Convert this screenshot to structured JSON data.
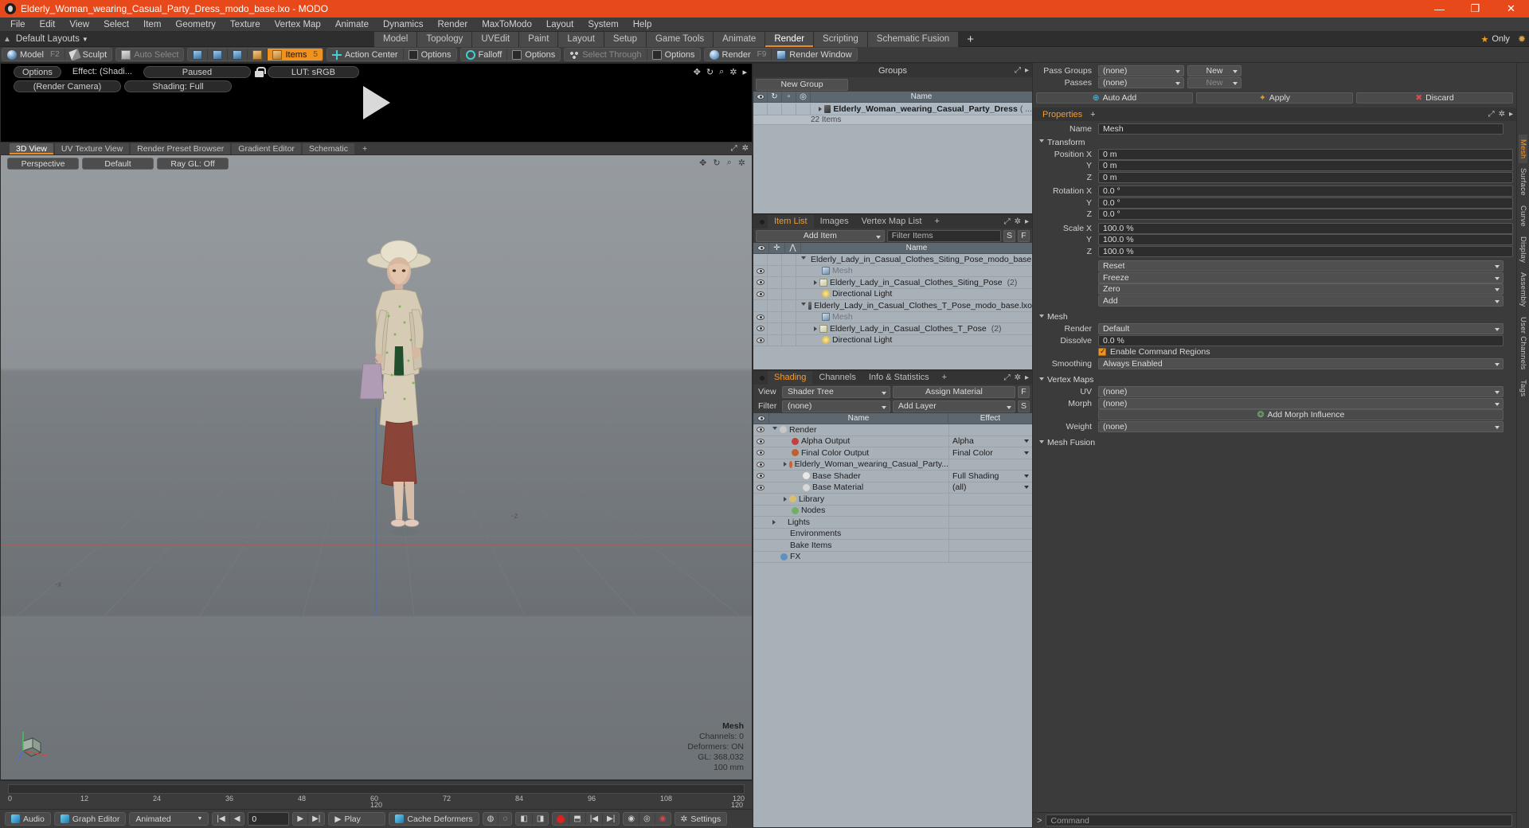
{
  "window": {
    "title": "Elderly_Woman_wearing_Casual_Party_Dress_modo_base.lxo - MODO",
    "minimize": "—",
    "maximize": "❐",
    "close": "✕"
  },
  "menu": [
    "File",
    "Edit",
    "View",
    "Select",
    "Item",
    "Geometry",
    "Texture",
    "Vertex Map",
    "Animate",
    "Dynamics",
    "Render",
    "MaxToModo",
    "Layout",
    "System",
    "Help"
  ],
  "layout_row": {
    "layout_selector": "Default Layouts",
    "tabs": [
      {
        "label": "Model",
        "active": false
      },
      {
        "label": "Topology",
        "active": false
      },
      {
        "label": "UVEdit",
        "active": false
      },
      {
        "label": "Paint",
        "active": false
      },
      {
        "label": "Layout",
        "active": false
      },
      {
        "label": "Setup",
        "active": false
      },
      {
        "label": "Game Tools",
        "active": false
      },
      {
        "label": "Animate",
        "active": false
      },
      {
        "label": "Render",
        "active": true
      },
      {
        "label": "Scripting",
        "active": false
      },
      {
        "label": "Schematic Fusion",
        "active": false
      },
      {
        "label": "+",
        "active": false
      }
    ],
    "only_label": "Only"
  },
  "toolbar": {
    "mode_group": [
      {
        "label": "Model",
        "key": "F2",
        "icon": "sphere-icon",
        "active": false
      },
      {
        "label": "Sculpt",
        "key": "",
        "icon": "brush-icon",
        "active": false
      }
    ],
    "select_group": [
      {
        "label": "Auto Select",
        "icon": "cube-icon",
        "dim": true
      }
    ],
    "component_icons": [
      "vertex-mode-icon",
      "edge-mode-icon",
      "polygon-mode-icon",
      "material-mode-icon"
    ],
    "items_button": {
      "label": "Items",
      "key": "5",
      "active": true,
      "icon": "items-cube-icon"
    },
    "action_center": {
      "label": "Action Center",
      "icon": "action-center-icon"
    },
    "options_1": {
      "label": "Options",
      "icon": "options-icon"
    },
    "falloff": {
      "label": "Falloff",
      "icon": "falloff-icon"
    },
    "options_2": {
      "label": "Options",
      "icon": "options-icon"
    },
    "select_through": {
      "label": "Select Through",
      "icon": "select-through-icon",
      "dim": true
    },
    "options_3": {
      "label": "Options",
      "icon": "options-icon"
    },
    "render": {
      "label": "Render",
      "key": "F9",
      "icon": "render-icon"
    },
    "render_window": {
      "label": "Render Window",
      "icon": "render-window-icon"
    }
  },
  "preview": {
    "options": "Options",
    "effect": "Effect: (Shadi...",
    "paused": "Paused",
    "lut": "LUT: sRGB",
    "camera": "(Render Camera)",
    "shading": "Shading: Full",
    "icons": [
      "move-icon",
      "rotate-icon",
      "zoom-icon",
      "gear-icon",
      "chevron-right-icon"
    ]
  },
  "viewport": {
    "tabs": [
      {
        "label": "3D View",
        "active": true
      },
      {
        "label": "UV Texture View",
        "active": false
      },
      {
        "label": "Render Preset Browser",
        "active": false
      },
      {
        "label": "Gradient Editor",
        "active": false
      },
      {
        "label": "Schematic",
        "active": false
      },
      {
        "label": "+",
        "active": false
      }
    ],
    "perspective": "Perspective",
    "default": "Default",
    "raygl": "Ray GL: Off",
    "icons": [
      "move-icon",
      "rotate-icon",
      "zoom-icon",
      "gear-icon"
    ],
    "stats": {
      "title": "Mesh",
      "channels": "Channels: 0",
      "deformers": "Deformers: ON",
      "gl": "GL: 368,032",
      "scale": "100 mm"
    },
    "axis_labels": {
      "z_minus": "-z",
      "x_minus": "-x"
    }
  },
  "timeline": {
    "ticks": [
      "0",
      "12",
      "24",
      "36",
      "48",
      "60",
      "72",
      "84",
      "96",
      "108",
      "120"
    ],
    "center": "120",
    "right": "120"
  },
  "bottom_bar": {
    "audio": "Audio",
    "graph_editor": "Graph Editor",
    "animated": "Animated",
    "frame_value": "0",
    "play": "Play",
    "cache_deformers": "Cache Deformers",
    "settings": "Settings"
  },
  "groups_panel": {
    "title": "Groups",
    "new_group_button": "New Group",
    "columns": [
      "eye",
      "sync",
      "lock",
      "render",
      "Name"
    ],
    "items": [
      {
        "name": "Elderly_Woman_wearing_Casual_Party_Dress",
        "suffix": "( ...",
        "sub": "22 Items"
      }
    ]
  },
  "item_list_panel": {
    "tabs": [
      {
        "label": "Item List",
        "active": true
      },
      {
        "label": "Images",
        "active": false
      },
      {
        "label": "Vertex Map List",
        "active": false
      },
      {
        "label": "+",
        "active": false
      }
    ],
    "add_item_button": "Add Item",
    "filter_placeholder": "Filter Items",
    "filter_s": "S",
    "filter_f": "F",
    "columns": [
      "eye",
      "move",
      "axis",
      "Name"
    ],
    "rows": [
      {
        "indent": 0,
        "tri": "down",
        "icon": "clapboard-icon",
        "name": "Elderly_Lady_in_Casual_Clothes_Siting_Pose_modo_base.lxo",
        "dim": false,
        "eye": false
      },
      {
        "indent": 1,
        "tri": "none",
        "icon": "mesh-icon",
        "name": "Mesh",
        "dim": true,
        "eye": true
      },
      {
        "indent": 1,
        "tri": "right",
        "icon": "folder-icon",
        "name": "Elderly_Lady_in_Casual_Clothes_Siting_Pose",
        "suffix": "(2)",
        "dim": false,
        "eye": true
      },
      {
        "indent": 1,
        "tri": "none",
        "icon": "light-icon",
        "name": "Directional Light",
        "dim": false,
        "eye": true
      },
      {
        "indent": 0,
        "tri": "down",
        "icon": "clapboard-icon",
        "name": "Elderly_Lady_in_Casual_Clothes_T_Pose_modo_base.lxo",
        "dim": false,
        "eye": false
      },
      {
        "indent": 1,
        "tri": "none",
        "icon": "mesh-icon",
        "name": "Mesh",
        "dim": true,
        "eye": true
      },
      {
        "indent": 1,
        "tri": "right",
        "icon": "folder-icon",
        "name": "Elderly_Lady_in_Casual_Clothes_T_Pose",
        "suffix": "(2)",
        "dim": false,
        "eye": true
      },
      {
        "indent": 1,
        "tri": "none",
        "icon": "light-icon",
        "name": "Directional Light",
        "dim": false,
        "eye": true
      }
    ]
  },
  "shading_panel": {
    "tabs": [
      {
        "label": "Shading",
        "active": true
      },
      {
        "label": "Channels",
        "active": false
      },
      {
        "label": "Info & Statistics",
        "active": false
      },
      {
        "label": "+",
        "active": false
      }
    ],
    "view_label": "View",
    "view_value": "Shader Tree",
    "assign_material": "Assign Material",
    "assign_f": "F",
    "filter_label": "Filter",
    "filter_value": "(none)",
    "add_layer": "Add Layer",
    "add_layer_s": "S",
    "columns": [
      "eye",
      "Name",
      "Effect"
    ],
    "rows": [
      {
        "indent": 0,
        "tri": "down",
        "icon": "render-icon",
        "name": "Render",
        "effect": "",
        "eye": true
      },
      {
        "indent": 1,
        "tri": "none",
        "icon": "alpha-icon",
        "name": "Alpha Output",
        "effect": "Alpha",
        "eye": true,
        "dd": true
      },
      {
        "indent": 1,
        "tri": "none",
        "icon": "color-icon",
        "name": "Final Color Output",
        "effect": "Final Color",
        "eye": true,
        "dd": true
      },
      {
        "indent": 1,
        "tri": "right",
        "icon": "material-icon",
        "name": "Elderly_Woman_wearing_Casual_Party...",
        "effect": "",
        "eye": true
      },
      {
        "indent": 2,
        "tri": "none",
        "icon": "shader-icon",
        "name": "Base Shader",
        "effect": "Full Shading",
        "eye": true,
        "dd": true
      },
      {
        "indent": 2,
        "tri": "none",
        "icon": "basemat-icon",
        "name": "Base Material",
        "effect": "(all)",
        "eye": true,
        "dd": true
      },
      {
        "indent": 1,
        "tri": "right",
        "icon": "library-icon",
        "name": "Library",
        "effect": "",
        "eye": false
      },
      {
        "indent": 1,
        "tri": "none",
        "icon": "nodes-icon",
        "name": "Nodes",
        "effect": "",
        "eye": false
      },
      {
        "indent": 0,
        "tri": "right",
        "icon": "none",
        "name": "Lights",
        "effect": "",
        "eye": false
      },
      {
        "indent": 0,
        "tri": "none",
        "icon": "none",
        "name": "Environments",
        "effect": "",
        "eye": false
      },
      {
        "indent": 0,
        "tri": "none",
        "icon": "none",
        "name": "Bake Items",
        "effect": "",
        "eye": false
      },
      {
        "indent": 0,
        "tri": "none",
        "icon": "fx-icon",
        "name": "FX",
        "effect": "",
        "eye": false
      }
    ]
  },
  "properties": {
    "pass_groups_label": "Pass Groups",
    "pass_groups_value": "(none)",
    "new_button": "New",
    "passes_label": "Passes",
    "passes_value": "(none)",
    "new_button_2": "New",
    "auto_add": "Auto Add",
    "apply": "Apply",
    "discard": "Discard",
    "header": "Properties",
    "header_plus": "+",
    "name_label": "Name",
    "name_value": "Mesh",
    "transform_section": "Transform",
    "position": {
      "label": "Position X",
      "x": "0 m",
      "y": "0 m",
      "z": "0 m"
    },
    "rotation": {
      "label": "Rotation X",
      "x": "0.0 °",
      "y": "0.0 °",
      "z": "0.0 °"
    },
    "scale": {
      "label": "Scale X",
      "x": "100.0 %",
      "y": "100.0 %",
      "z": "100.0 %"
    },
    "transform_actions": [
      "Reset",
      "Freeze",
      "Zero",
      "Add"
    ],
    "mesh_section": "Mesh",
    "render_label": "Render",
    "render_value": "Default",
    "dissolve_label": "Dissolve",
    "dissolve_value": "0.0 %",
    "enable_command_regions": "Enable Command Regions",
    "smoothing_label": "Smoothing",
    "smoothing_value": "Always Enabled",
    "vertex_maps_section": "Vertex Maps",
    "uv_label": "UV",
    "uv_value": "(none)",
    "morph_label": "Morph",
    "morph_value": "(none)",
    "add_morph_influence": "Add Morph Influence",
    "weight_label": "Weight",
    "weight_value": "(none)",
    "mesh_fusion_section": "Mesh Fusion",
    "side_tabs": [
      {
        "label": "Mesh",
        "active": true
      },
      {
        "label": "Surface",
        "active": false
      },
      {
        "label": "Curve",
        "active": false
      },
      {
        "label": "Display",
        "active": false
      },
      {
        "label": "Assembly",
        "active": false
      },
      {
        "label": "User Channels",
        "active": false
      },
      {
        "label": "Tags",
        "active": false
      }
    ]
  },
  "command_bar": {
    "prompt": ">",
    "placeholder": "Command"
  },
  "colors": {
    "accent_orange": "#f0921e",
    "title_bar": "#e8491b",
    "panel_bg": "#3b3b3b",
    "list_bg": "#a8b0b8",
    "header_blue": "#5d6770"
  }
}
